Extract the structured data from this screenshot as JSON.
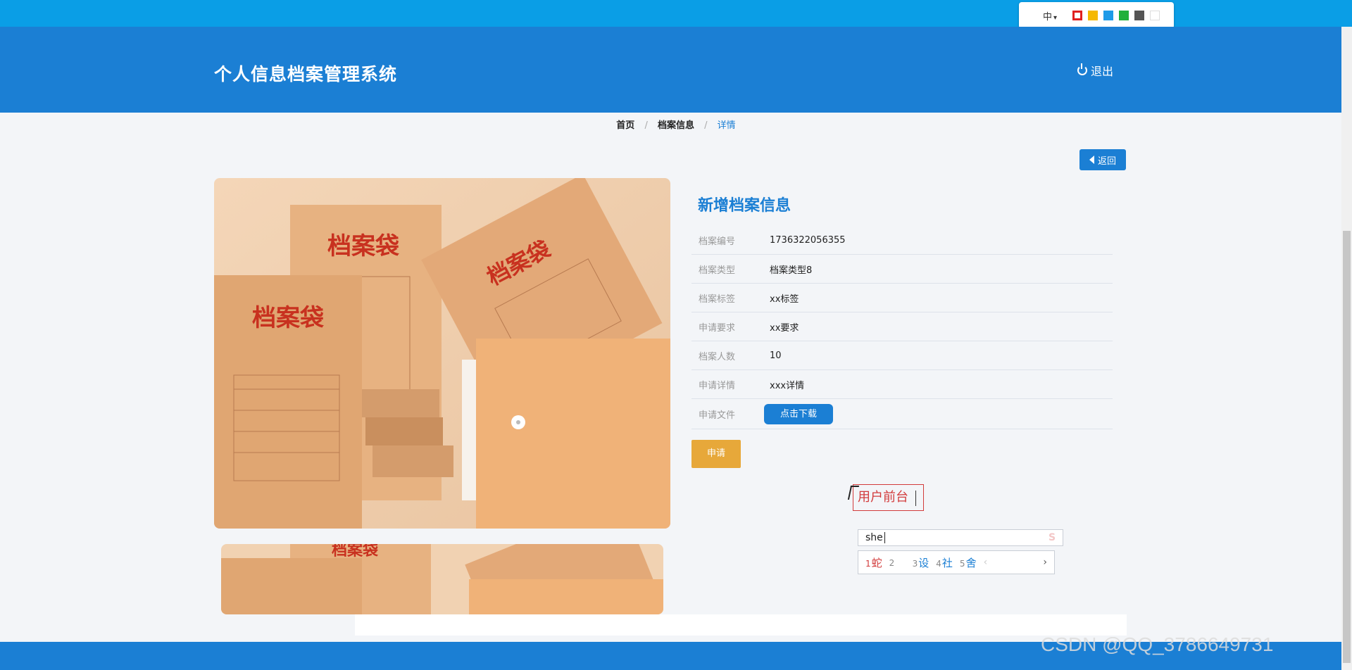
{
  "ime_toolbar": {
    "language": "中",
    "swatches": [
      "#e02020",
      "#f5b800",
      "#1e9be8",
      "#22b03a",
      "#555555",
      "#ffffff"
    ]
  },
  "header": {
    "title": "个人信息档案管理系统",
    "logout_label": "退出"
  },
  "breadcrumb": {
    "items": [
      "首页",
      "档案信息",
      "详情"
    ],
    "separator": "/"
  },
  "back_button": "返回",
  "detail": {
    "title": "新增档案信息",
    "fields": [
      {
        "label": "档案编号",
        "value": "1736322056355"
      },
      {
        "label": "档案类型",
        "value": "档案类型8"
      },
      {
        "label": "档案标签",
        "value": "xx标签"
      },
      {
        "label": "申请要求",
        "value": "xx要求"
      },
      {
        "label": "档案人数",
        "value": "10"
      },
      {
        "label": "申请详情",
        "value": "xxx详情"
      },
      {
        "label": "申请文件",
        "button": "点击下载"
      }
    ],
    "apply_label": "申请"
  },
  "ime_popup": {
    "compose_text": "用户前台",
    "input_text": "she",
    "candidates": [
      {
        "n": "1",
        "text": "蛇"
      },
      {
        "n": "2",
        "text": ""
      },
      {
        "n": "3",
        "text": "设"
      },
      {
        "n": "4",
        "text": "社"
      },
      {
        "n": "5",
        "text": "舍"
      }
    ]
  },
  "photo_text": "档案袋",
  "watermark": "CSDN @QQ_3786649731"
}
